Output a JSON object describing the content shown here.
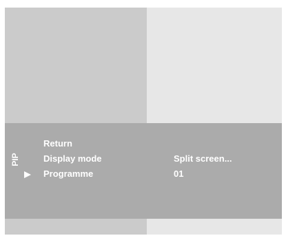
{
  "osd": {
    "title": "PIP",
    "items": [
      {
        "label": "Return",
        "value": "",
        "selected": false
      },
      {
        "label": "Display mode",
        "value": "Split screen...",
        "selected": false
      },
      {
        "label": "Programme",
        "value": "01",
        "selected": true
      }
    ],
    "cursor_icon": "triangle-right-icon"
  },
  "colors": {
    "panel_background": "#ababab",
    "left_pane": "#cbcbcb",
    "right_pane": "#e7e7e7",
    "text": "#ffffff"
  }
}
